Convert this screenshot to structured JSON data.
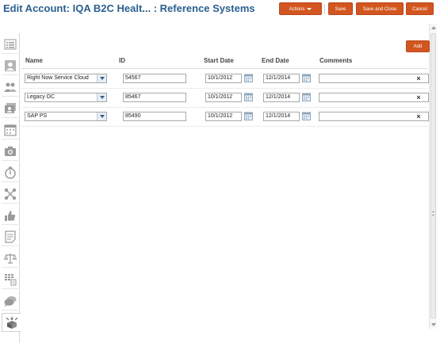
{
  "header": {
    "title": "Edit Account: IQA B2C Healt... : Reference Systems",
    "actions_label": "Actions",
    "save_label": "Save",
    "save_close_label": "Save and Close",
    "cancel_label": "Cancel"
  },
  "toolbar": {
    "add_label": "Add"
  },
  "table": {
    "columns": [
      "Name",
      "ID",
      "Start Date",
      "End Date",
      "Comments"
    ],
    "rows": [
      {
        "name": "Right Now Service Cloud",
        "id": "54567",
        "start": "10/1/2012",
        "end": "12/1/2014",
        "comments": ""
      },
      {
        "name": "Legacy OC",
        "id": "85467",
        "start": "10/1/2012",
        "end": "12/1/2014",
        "comments": ""
      },
      {
        "name": "SAP PS",
        "id": "85490",
        "start": "10/1/2012",
        "end": "12/1/2014",
        "comments": ""
      }
    ],
    "delete_glyph": "×"
  },
  "sidebar": {
    "icons": [
      "list-icon",
      "contact-card-icon",
      "people-icon",
      "contacts-icon",
      "calendar-icon",
      "camera-icon",
      "timer-icon",
      "network-icon",
      "thumbs-up-icon",
      "notes-icon",
      "scales-icon",
      "table-doc-icon",
      "chat-icon",
      "reference-systems-icon"
    ]
  },
  "colors": {
    "accent": "#d2561f",
    "title": "#2b5f8e",
    "icon": "#9a9a9a"
  }
}
